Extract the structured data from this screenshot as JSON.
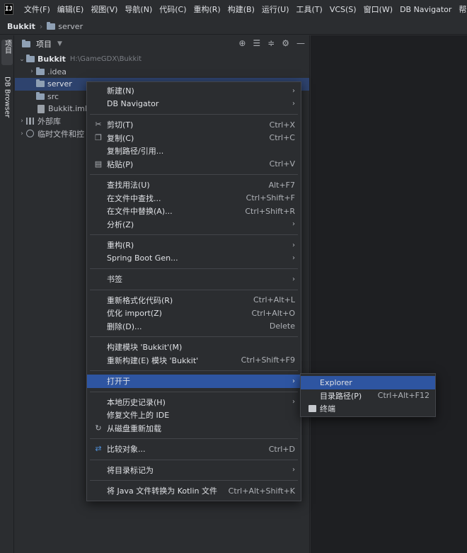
{
  "app": {
    "logo_text": "IJ"
  },
  "menubar": [
    "文件(F)",
    "编辑(E)",
    "视图(V)",
    "导航(N)",
    "代码(C)",
    "重构(R)",
    "构建(B)",
    "运行(U)",
    "工具(T)",
    "VCS(S)",
    "窗口(W)",
    "DB Navigator",
    "帮助("
  ],
  "breadcrumb": {
    "root": "Bukkit",
    "child": "server"
  },
  "toolstrip": {
    "project_tab": "项目",
    "db_tab": "DB Browser"
  },
  "panel": {
    "title": "项目",
    "tree": {
      "root": {
        "name": "Bukkit",
        "path": "H:\\GameGDX\\Bukkit"
      },
      "idea": ".idea",
      "server": "server",
      "src": "src",
      "iml": "Bukkit.iml",
      "external": "外部库",
      "scratch": "临时文件和控"
    }
  },
  "context_menu": {
    "new": {
      "label": "新建(N)"
    },
    "dbnav": {
      "label": "DB Navigator"
    },
    "cut": {
      "label": "剪切(T)",
      "shortcut": "Ctrl+X"
    },
    "copy": {
      "label": "复制(C)",
      "shortcut": "Ctrl+C"
    },
    "copy_path": {
      "label": "复制路径/引用..."
    },
    "paste": {
      "label": "粘贴(P)",
      "shortcut": "Ctrl+V"
    },
    "find_usages": {
      "label": "查找用法(U)",
      "shortcut": "Alt+F7"
    },
    "find_in_files": {
      "label": "在文件中查找...",
      "shortcut": "Ctrl+Shift+F"
    },
    "replace_in_files": {
      "label": "在文件中替换(A)...",
      "shortcut": "Ctrl+Shift+R"
    },
    "analyze": {
      "label": "分析(Z)"
    },
    "refactor": {
      "label": "重构(R)"
    },
    "spring_boot": {
      "label": "Spring Boot Gen..."
    },
    "bookmarks": {
      "label": "书签"
    },
    "reformat": {
      "label": "重新格式化代码(R)",
      "shortcut": "Ctrl+Alt+L"
    },
    "optimize": {
      "label": "优化 import(Z)",
      "shortcut": "Ctrl+Alt+O"
    },
    "delete": {
      "label": "删除(D)...",
      "shortcut": "Delete"
    },
    "build_module": {
      "label": "构建模块 'Bukkit'(M)"
    },
    "rebuild_module": {
      "label": "重新构建(E) 模块 'Bukkit'",
      "shortcut": "Ctrl+Shift+F9"
    },
    "open_in": {
      "label": "打开于"
    },
    "local_history": {
      "label": "本地历史记录(H)"
    },
    "repair_ide": {
      "label": "修复文件上的 IDE"
    },
    "reload": {
      "label": "从磁盘重新加载"
    },
    "compare": {
      "label": "比较对象...",
      "shortcut": "Ctrl+D"
    },
    "mark_dir": {
      "label": "将目录标记为"
    },
    "convert_kotlin": {
      "label": "将 Java 文件转换为 Kotlin 文件",
      "shortcut": "Ctrl+Alt+Shift+K"
    }
  },
  "submenu": {
    "explorer": {
      "label": "Explorer"
    },
    "dir_path": {
      "label": "目录路径(P)",
      "shortcut": "Ctrl+Alt+F12"
    },
    "terminal": {
      "label": "终端"
    }
  },
  "colors": {
    "background": "#2b2d30",
    "selection": "#2e436e",
    "highlight": "#2e55a1",
    "editor": "#1e1f22"
  }
}
